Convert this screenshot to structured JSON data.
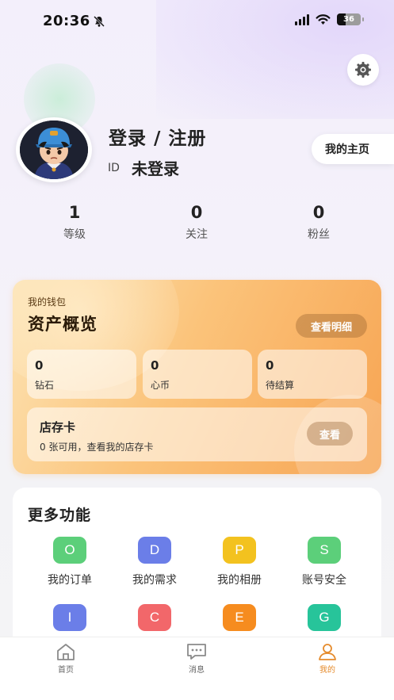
{
  "status_bar": {
    "time": "20:36",
    "battery": "36"
  },
  "profile": {
    "login_title": "登录 / 注册",
    "id_label": "ID",
    "id_value": "未登录",
    "homepage_label": "我的主页"
  },
  "stats": [
    {
      "value": "1",
      "label": "等级"
    },
    {
      "value": "0",
      "label": "关注"
    },
    {
      "value": "0",
      "label": "粉丝"
    }
  ],
  "wallet": {
    "subtitle": "我的钱包",
    "title": "资产概览",
    "detail_button": "查看明细",
    "balances": [
      {
        "value": "0",
        "label": "钻石"
      },
      {
        "value": "0",
        "label": "心币"
      },
      {
        "value": "0",
        "label": "待结算"
      }
    ],
    "store_card": {
      "title": "店存卡",
      "desc": "0 张可用，查看我的店存卡",
      "button": "查看"
    }
  },
  "more": {
    "title": "更多功能",
    "items": [
      {
        "letter": "O",
        "label": "我的订单",
        "color": "#5ccf7a"
      },
      {
        "letter": "D",
        "label": "我的需求",
        "color": "#6b7ee8"
      },
      {
        "letter": "P",
        "label": "我的相册",
        "color": "#f3c21f"
      },
      {
        "letter": "S",
        "label": "账号安全",
        "color": "#5ccf7a"
      },
      {
        "letter": "I",
        "label": "",
        "color": "#6b7ee8"
      },
      {
        "letter": "C",
        "label": "",
        "color": "#f2676a"
      },
      {
        "letter": "E",
        "label": "",
        "color": "#f68c1f"
      },
      {
        "letter": "G",
        "label": "",
        "color": "#27c49a"
      }
    ]
  },
  "tabbar": [
    {
      "label": "首页",
      "icon": "home-icon"
    },
    {
      "label": "消息",
      "icon": "message-icon"
    },
    {
      "label": "我的",
      "icon": "profile-icon"
    }
  ],
  "colors": {
    "accent": "#e58b2c",
    "wallet_start": "#fce3b3",
    "wallet_end": "#f7a452"
  }
}
